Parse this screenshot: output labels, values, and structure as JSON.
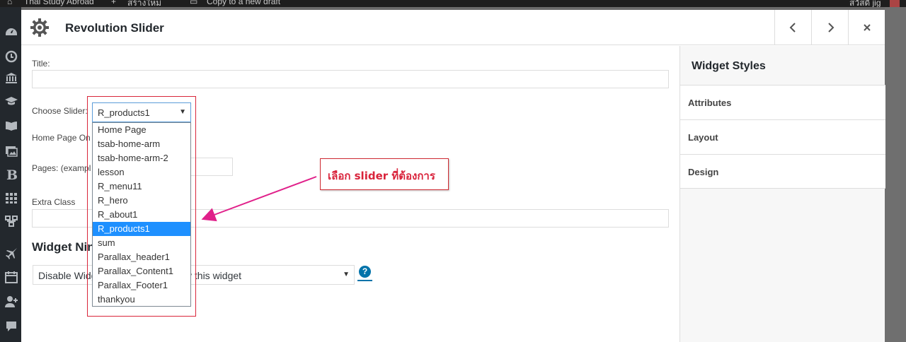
{
  "adminbar": {
    "site_name": "Thai Study Abroad",
    "new_label": "สร้างใหม่",
    "copy_draft": "Copy to a new draft",
    "greeting": "สวัสดี jig"
  },
  "modal": {
    "title": "Revolution Slider",
    "prev_label": "‹",
    "next_label": "›",
    "close_label": "×"
  },
  "form": {
    "title_label": "Title:",
    "title_value": "",
    "choose_slider_label": "Choose Slider:",
    "home_page_only_label": "Home Page On",
    "pages_label": "Pages: (exampl",
    "pages_value": "",
    "extra_class_label": "Extra Class",
    "extra_class_value": "",
    "widget_section_heading": "Widget Nin",
    "widget_select_value": "Disable Widg",
    "widget_select_value_tail": "y this widget",
    "help_label": "?"
  },
  "slider_select": {
    "selected": "R_products1",
    "options": [
      "Home Page",
      "tsab-home-arm",
      "tsab-home-arm-2",
      "lesson",
      "R_menu11",
      "R_hero",
      "R_about1",
      "R_products1",
      "sum",
      "Parallax_header1",
      "Parallax_Content1",
      "Parallax_Footer1",
      "thankyou"
    ],
    "highlighted_index": 7
  },
  "annotation": {
    "text": "เลือก slider ที่ต้องการ",
    "color": "#d9233b"
  },
  "widget_styles": {
    "title": "Widget Styles",
    "sections": [
      "Attributes",
      "Layout",
      "Design"
    ]
  },
  "colors": {
    "accent": "#0073aa",
    "highlight": "#1e90ff",
    "annotation_red": "#d9263a"
  }
}
